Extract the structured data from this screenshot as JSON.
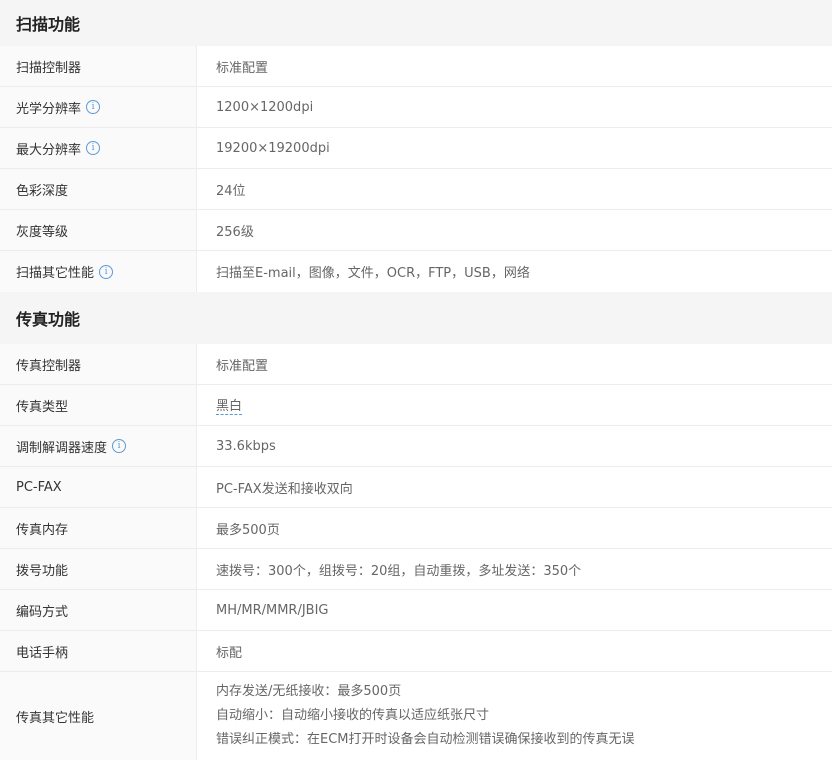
{
  "sections": [
    {
      "title": "扫描功能",
      "rows": [
        {
          "label": "扫描控制器",
          "value": "标准配置"
        },
        {
          "label": "光学分辨率",
          "value": "1200×1200dpi"
        },
        {
          "label": "最大分辨率",
          "value": "19200×19200dpi"
        },
        {
          "label": "色彩深度",
          "value": "24位"
        },
        {
          "label": "灰度等级",
          "value": "256级"
        },
        {
          "label": "扫描其它性能",
          "value": "扫描至E-mail，图像，文件，OCR，FTP，USB，网络"
        }
      ]
    },
    {
      "title": "传真功能",
      "rows": [
        {
          "label": "传真控制器",
          "value": "标准配置"
        },
        {
          "label": "传真类型",
          "value": "黑白"
        },
        {
          "label": "调制解调器速度",
          "value": "33.6kbps"
        },
        {
          "label": "PC-FAX",
          "value": "PC-FAX发送和接收双向"
        },
        {
          "label": "传真内存",
          "value": "最多500页"
        },
        {
          "label": "拨号功能",
          "value": "速拨号：300个，组拨号：20组，自动重拨，多址发送：350个"
        },
        {
          "label": "编码方式",
          "value": "MH/MR/MMR/JBIG"
        },
        {
          "label": "电话手柄",
          "value": "标配"
        },
        {
          "label": "传真其它性能",
          "value_lines": [
            "内存发送/无纸接收：最多500页",
            "自动缩小：自动缩小接收的传真以适应纸张尺寸",
            "错误纠正模式：在ECM打开时设备会自动检测错误确保接收到的传真无误"
          ]
        }
      ]
    }
  ],
  "colors": {
    "header_bg": "#f5f5f5",
    "label_bg": "#fafafa",
    "border": "#ececec",
    "info_icon": "#5b9bd5"
  },
  "icons": {
    "info": "i"
  }
}
